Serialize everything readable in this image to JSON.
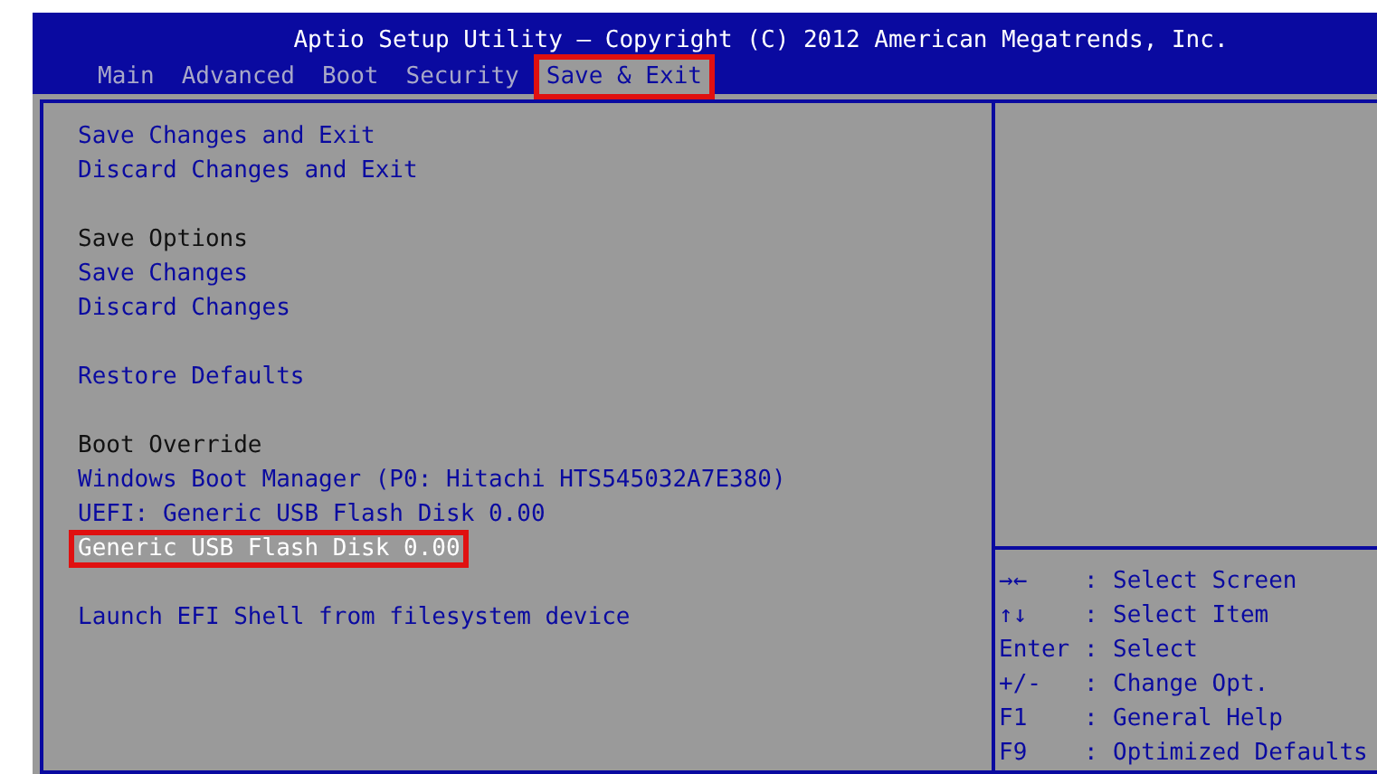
{
  "header": {
    "title": "Aptio Setup Utility – Copyright (C) 2012 American Megatrends, Inc."
  },
  "tabs": [
    {
      "label": "Main",
      "selected": false
    },
    {
      "label": "Advanced",
      "selected": false
    },
    {
      "label": "Boot",
      "selected": false
    },
    {
      "label": "Security",
      "selected": false
    },
    {
      "label": "Save & Exit",
      "selected": true
    }
  ],
  "menu_groups": [
    {
      "items": [
        {
          "kind": "option",
          "label": "Save Changes and Exit",
          "selected": false
        },
        {
          "kind": "option",
          "label": "Discard Changes and Exit",
          "selected": false
        }
      ]
    },
    {
      "items": [
        {
          "kind": "heading",
          "label": "Save Options",
          "selected": false
        },
        {
          "kind": "option",
          "label": "Save Changes",
          "selected": false
        },
        {
          "kind": "option",
          "label": "Discard Changes",
          "selected": false
        }
      ]
    },
    {
      "items": [
        {
          "kind": "option",
          "label": "Restore Defaults",
          "selected": false
        }
      ]
    },
    {
      "items": [
        {
          "kind": "heading",
          "label": "Boot Override",
          "selected": false
        },
        {
          "kind": "option",
          "label": "Windows Boot Manager (P0: Hitachi HTS545032A7E380)",
          "selected": false
        },
        {
          "kind": "option",
          "label": "UEFI: Generic USB Flash Disk 0.00",
          "selected": false
        },
        {
          "kind": "option",
          "label": "Generic USB Flash Disk 0.00",
          "selected": true
        }
      ]
    },
    {
      "items": [
        {
          "kind": "option",
          "label": "Launch EFI Shell from filesystem device",
          "selected": false
        }
      ]
    }
  ],
  "help": [
    {
      "key": "→←",
      "separator": ":",
      "action": "Select Screen"
    },
    {
      "key": "↑↓",
      "separator": ":",
      "action": "Select Item"
    },
    {
      "key": "Enter",
      "separator": ":",
      "action": "Select"
    },
    {
      "key": "+/-",
      "separator": ":",
      "action": "Change Opt."
    },
    {
      "key": "F1",
      "separator": ":",
      "action": "General Help"
    },
    {
      "key": "F9",
      "separator": ":",
      "action": "Optimized Defaults"
    }
  ]
}
